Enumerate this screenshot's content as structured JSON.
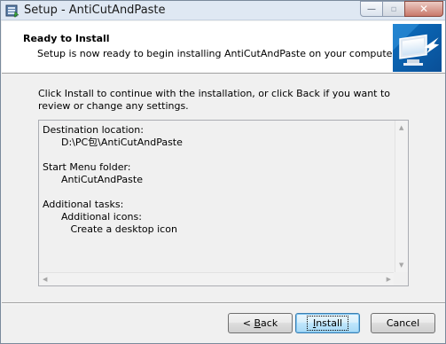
{
  "window": {
    "title": "Setup - AntiCutAndPaste",
    "min_glyph": "—",
    "max_glyph": "▫",
    "close_glyph": "✕"
  },
  "header": {
    "title": "Ready to Install",
    "subtitle": "Setup is now ready to begin installing AntiCutAndPaste on your computer."
  },
  "description": "Click Install to continue with the installation, or click Back if you want to review or change any settings.",
  "memo": {
    "text": "Destination location:\n      D:\\PC包\\AntiCutAndPaste\n\nStart Menu folder:\n      AntiCutAndPaste\n\nAdditional tasks:\n      Additional icons:\n         Create a desktop icon"
  },
  "buttons": {
    "back_prefix": "< ",
    "back_accel": "B",
    "back_rest": "ack",
    "install_accel": "I",
    "install_rest": "nstall",
    "cancel": "Cancel"
  },
  "icons": {
    "app": "setup-app-icon",
    "header_art": "computer-install-arrow-icon"
  }
}
